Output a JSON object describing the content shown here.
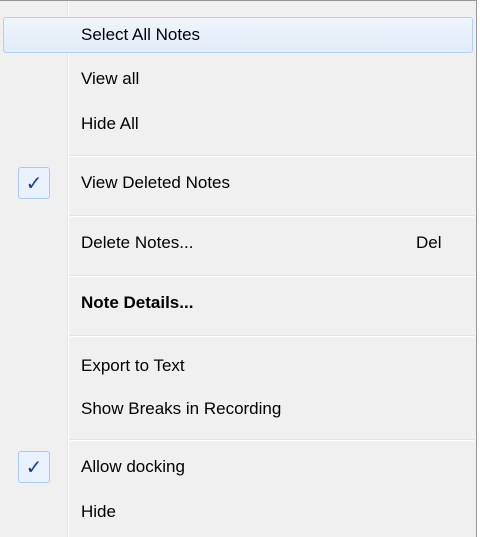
{
  "menu": {
    "items": [
      {
        "label": "Select All Notes"
      },
      {
        "label": "View all"
      },
      {
        "label": "Hide All"
      },
      {
        "label": "View Deleted Notes",
        "checked": true
      },
      {
        "label": "Delete Notes...",
        "shortcut": "Del"
      },
      {
        "label": "Note Details..."
      },
      {
        "label": "Export to Text"
      },
      {
        "label": "Show Breaks in Recording"
      },
      {
        "label": "Allow docking",
        "checked": true
      },
      {
        "label": "Hide"
      }
    ],
    "check_icon": "✓"
  },
  "colors": {
    "menu_background": "#f0f0f0",
    "highlight_border": "#aecff7",
    "check_color": "#1f3f8f"
  }
}
